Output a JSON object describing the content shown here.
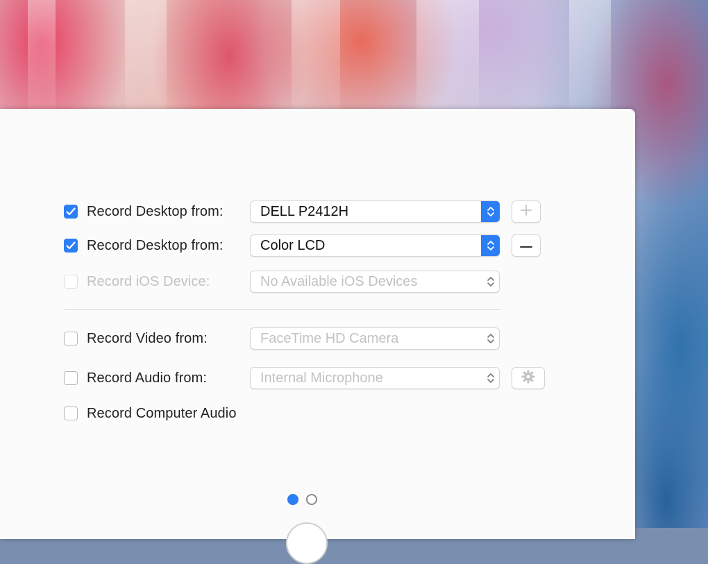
{
  "rows": [
    {
      "label": "Record Desktop from:",
      "checked": true,
      "disabled": false,
      "select": "DELL P2412H",
      "select_active": true
    },
    {
      "label": "Record Desktop from:",
      "checked": true,
      "disabled": false,
      "select": "Color LCD",
      "select_active": true
    },
    {
      "label": "Record iOS Device:",
      "checked": false,
      "disabled": true,
      "select": "No Available iOS Devices",
      "select_active": false
    },
    {
      "label": "Record Video from:",
      "checked": false,
      "disabled": false,
      "select": "FaceTime HD Camera",
      "select_active": false
    },
    {
      "label": "Record Audio from:",
      "checked": false,
      "disabled": false,
      "select": "Internal Microphone",
      "select_active": false
    },
    {
      "label": "Record Computer Audio",
      "checked": false,
      "disabled": false
    }
  ],
  "buttons": {
    "add": "plus-icon",
    "remove": "minus-icon",
    "audio_settings": "gear-icon"
  },
  "pager": {
    "pages": 2,
    "current": 1
  },
  "colors": {
    "accent": "#2b7ef3",
    "panel": "#fbfbfb"
  }
}
